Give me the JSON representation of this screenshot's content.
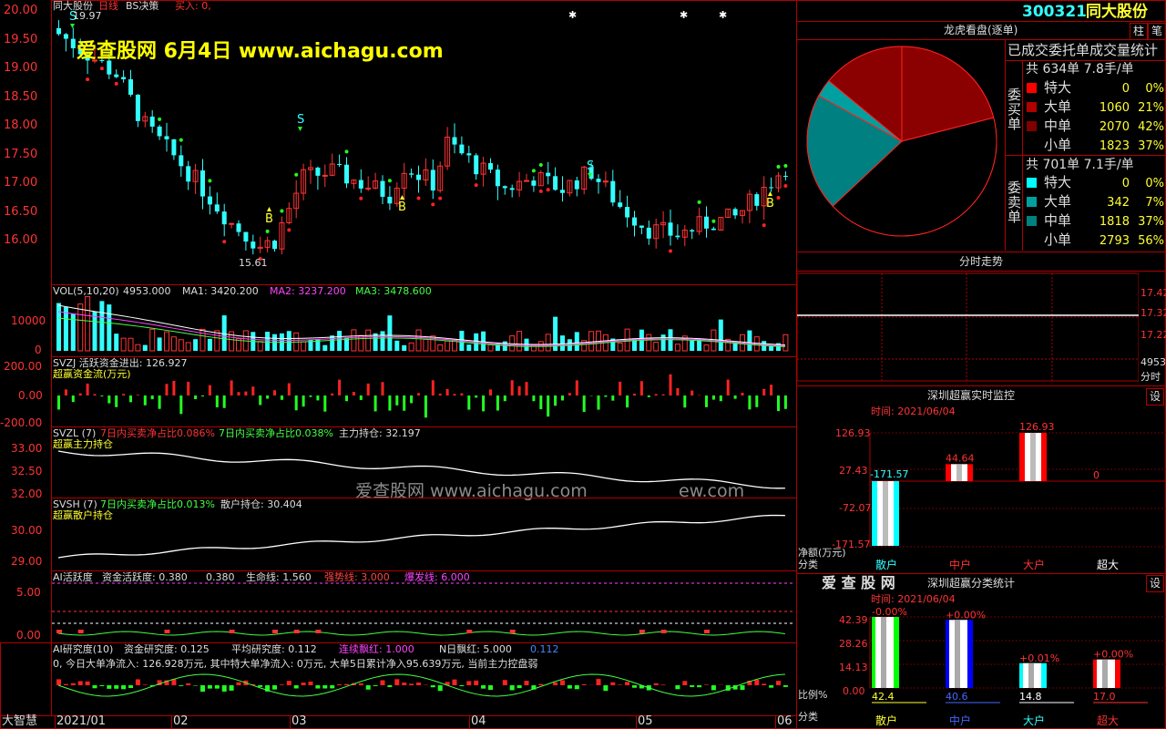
{
  "header": {
    "stock_name": "同大股份",
    "period": "日线",
    "strategy": "BS决策",
    "buy": "买入: 0,",
    "high_marker": "19.97",
    "low_marker": "15.61",
    "watermark_top": "爱查股网   6月4日   www.aichagu.com",
    "watermark_mid": "爱查股网    www.aichagu.com",
    "watermark_mid2": "ew.com"
  },
  "y_axis_main": [
    "20.00",
    "19.50",
    "19.00",
    "18.50",
    "18.00",
    "17.50",
    "17.00",
    "16.50",
    "16.00"
  ],
  "signals": {
    "s": "S",
    "b": "B"
  },
  "panels": {
    "vol": {
      "title": "VOL(5,10,20)",
      "value": "4953.000",
      "ma1": "MA1: 3420.200",
      "ma2": "MA2: 3237.200",
      "ma3": "MA3: 3478.600",
      "ticks": [
        "10000",
        "0"
      ]
    },
    "svzj": {
      "title": "SVZJ  活跃资金进出: 126.927",
      "subtitle": "超赢资金流(万元)",
      "ticks": [
        "200.00",
        "0.00",
        "-200.00"
      ]
    },
    "svzl": {
      "title": "SVZL (7)",
      "t2": "7日内买卖净占比0.086%",
      "t3": "7日内买卖净占比0.038%",
      "t4": "主力持仓: 32.197",
      "subtitle": "超赢主力持仓",
      "ticks": [
        "33.00",
        "32.50",
        "32.00"
      ]
    },
    "svsh": {
      "title": "SVSH (7)",
      "t2": "7日内买卖净占比0.013%",
      "t4": "散户持仓: 30.404",
      "subtitle": "超赢散户持仓",
      "ticks": [
        "30.00",
        "29.00"
      ]
    },
    "ai1": {
      "title": "AI活跃度",
      "t1": "资金活跃度: 0.380",
      "t2": "0.380",
      "t3": "生命线: 1.560",
      "t4": "强势线: 3.000",
      "t5": "爆发线: 6.000",
      "ticks": [
        "5.00",
        "0.00"
      ]
    },
    "ai2": {
      "title": "AI研究度(10)",
      "t1": "资金研究度: 0.125",
      "t2": "平均研究度: 0.112",
      "t3": "连续飘红: 1.000",
      "t4": "N日飘红: 5.000",
      "t5": "0.112",
      "line2": "0, 今日大单净流入: 126.928万元, 其中特大单净流入: 0万元, 大单5日累计净入95.639万元, 当前主力控盘弱"
    }
  },
  "x_axis": {
    "corner": "大智慧",
    "labels": [
      "2021/01",
      "02",
      "03",
      "04",
      "05",
      "06"
    ]
  },
  "right": {
    "code": "300321",
    "name": "同大股份",
    "btn_zhu": "柱",
    "btn_bi": "笔",
    "pie_title": "龙虎看盘(逐单)",
    "stats_title": "已成交委托单成交量统计",
    "buy": {
      "side_label": "委买单",
      "total": "共 634单 7.8手/单",
      "rows": [
        {
          "label": "特大",
          "value": "0",
          "pct": "0%",
          "color": "#ff0000"
        },
        {
          "label": "大单",
          "value": "1060",
          "pct": "21%",
          "color": "#b00000"
        },
        {
          "label": "中单",
          "value": "2070",
          "pct": "42%",
          "color": "#800000"
        },
        {
          "label": "小单",
          "value": "1823",
          "pct": "37%",
          "color": "#000000"
        }
      ]
    },
    "sell": {
      "side_label": "委卖单",
      "total": "共 701单 7.1手/单",
      "rows": [
        {
          "label": "特大",
          "value": "0",
          "pct": "0%",
          "color": "#00ffff"
        },
        {
          "label": "大单",
          "value": "342",
          "pct": "7%",
          "color": "#00a0a0"
        },
        {
          "label": "中单",
          "value": "1818",
          "pct": "37%",
          "color": "#008080"
        },
        {
          "label": "小单",
          "value": "2793",
          "pct": "56%",
          "color": "#000000"
        }
      ]
    },
    "pie": [
      {
        "name": "大单",
        "value": 21,
        "color": "#8b0000"
      },
      {
        "name": "中单",
        "value": 42,
        "color": "#000000"
      },
      {
        "name": "中单卖",
        "value": 20,
        "color": "#008080"
      },
      {
        "name": "大单卖",
        "value": 3,
        "color": "#00a0a0"
      },
      {
        "name": "小单",
        "value": 14,
        "color": "#8b0000"
      }
    ],
    "intraday_title": "分时走势",
    "intraday_ticks": [
      "17.42",
      "17.32",
      "17.22",
      "4953",
      "分时"
    ],
    "monitor_title": "深圳超赢实时监控",
    "monitor_btn": "设",
    "monitor_time": "时间: 2021/06/04",
    "monitor_ticks": [
      "126.93",
      "27.43",
      "-72.07",
      "-171.57"
    ],
    "monitor_ylabel": "净额(万元)",
    "monitor_xlabel": "分类",
    "monitor_bars": [
      {
        "name": "散户",
        "value": -171.57,
        "label": "-171.57",
        "color": "#00ffff"
      },
      {
        "name": "中户",
        "value": 44.64,
        "label": "44.64",
        "color": "#ff0000"
      },
      {
        "name": "大户",
        "value": 126.93,
        "label": "126.93",
        "color": "#ff0000"
      },
      {
        "name": "超大",
        "value": 0,
        "label": "0",
        "color": "#ff0000"
      }
    ],
    "stat_brand": "爱 查 股 网",
    "stat_title": "深圳超赢分类统计",
    "stat_btn": "设",
    "stat_time": "时间: 2021/06/04",
    "stat_ticks": [
      "42.39",
      "28.26",
      "14.13",
      "0.00"
    ],
    "stat_ylabel": "比例%",
    "stat_xlabel": "分类",
    "stat_bars": [
      {
        "name": "散户",
        "value": 42.4,
        "label": "42.4",
        "top": "-0.00%",
        "color": "#00ff00"
      },
      {
        "name": "中户",
        "value": 40.6,
        "label": "40.6",
        "top": "+0.00%",
        "color": "#0000ff"
      },
      {
        "name": "大户",
        "value": 14.8,
        "label": "14.8",
        "top": "+0.01%",
        "color": "#00ffff"
      },
      {
        "name": "超大",
        "value": 17.0,
        "label": "17.0",
        "top": "+0.00%",
        "color": "#ff0000"
      }
    ]
  }
}
